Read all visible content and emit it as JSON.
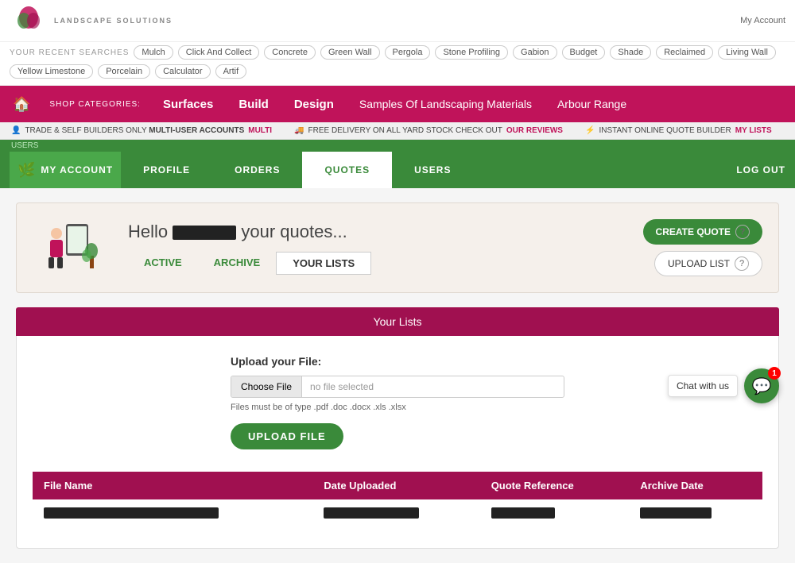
{
  "logo": {
    "company": "LANDSCAPE SOLUTIONS"
  },
  "recent_searches": {
    "label": "YOUR RECENT SEARCHES",
    "tags": [
      "Mulch",
      "Click And Collect",
      "Concrete",
      "Green Wall",
      "Pergola",
      "Stone Profiling",
      "Gabion",
      "Budget",
      "Shade",
      "Reclaimed",
      "Living Wall",
      "Yellow Limestone",
      "Porcelain",
      "Calculator",
      "Artif"
    ]
  },
  "nav": {
    "shop_label": "SHOP CATEGORIES:",
    "items": [
      {
        "label": "Surfaces"
      },
      {
        "label": "Build"
      },
      {
        "label": "Design"
      },
      {
        "label": "Samples Of Landscaping Materials"
      },
      {
        "label": "Arbour Range"
      }
    ]
  },
  "info_bar": {
    "items": [
      {
        "icon": "👤",
        "text": "TRADE & SELF BUILDERS ONLY MULTI-USER ACCOUNTS",
        "link": "MULTI"
      },
      {
        "icon": "🚚",
        "text": "FREE DELIVERY ON ALL YARD STOCK CHECK OUT",
        "link": "OUR REVIEWS"
      },
      {
        "icon": "⚡",
        "text": "INSTANT ONLINE QUOTE BUILDER",
        "link": "MY LISTS"
      }
    ]
  },
  "account_nav": {
    "logo_leaf": "🌿",
    "logo_label": "MY ACCOUNT",
    "tabs": [
      {
        "label": "PROFILE",
        "active": false
      },
      {
        "label": "ORDERS",
        "active": false
      },
      {
        "label": "QUOTES",
        "active": true
      },
      {
        "label": "USERS",
        "active": false
      }
    ],
    "logout": "LOG OUT",
    "breadcrumb": "USERS"
  },
  "banner": {
    "greeting": "Hello",
    "suffix": "your quotes...",
    "tabs": [
      {
        "label": "ACTIVE",
        "active": false
      },
      {
        "label": "ARCHIVE",
        "active": false
      },
      {
        "label": "YOUR LISTS",
        "active": true
      }
    ],
    "create_quote_btn": "CREATE QUOTE",
    "upload_list_btn": "UPLOAD LIST"
  },
  "your_lists": {
    "section_title": "Your Lists",
    "upload": {
      "label": "Upload your File:",
      "choose_btn": "Choose File",
      "placeholder": "no file selected",
      "hint": "Files must be of type .pdf .doc .docx .xls .xlsx",
      "upload_btn": "UPLOAD FILE"
    },
    "table": {
      "headers": [
        "File Name",
        "Date Uploaded",
        "Quote Reference",
        "Archive Date"
      ],
      "rows": [
        {
          "file_name_width": 220,
          "date_uploaded_width": 120,
          "quote_ref_width": 90,
          "archive_date_width": 110
        }
      ]
    }
  },
  "chat": {
    "label": "Chat with us",
    "badge": "1"
  }
}
